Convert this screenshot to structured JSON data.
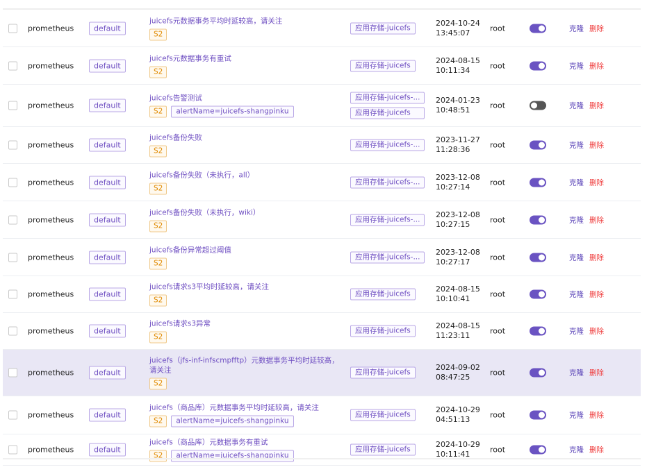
{
  "labels": {
    "clone": "克隆",
    "delete": "删除"
  },
  "rows": [
    {
      "source": "prometheus",
      "namespace": "default",
      "name": "juicefs元数据事务平均时延较高，请关注",
      "severity": "S2",
      "extra_label": null,
      "groups": [
        "应用存储-juicefs"
      ],
      "date": "2024-10-24",
      "time": "13:45:07",
      "user": "root",
      "enabled": true
    },
    {
      "source": "prometheus",
      "namespace": "default",
      "name": "juicefs元数据事务有重试",
      "severity": "S2",
      "extra_label": null,
      "groups": [
        "应用存储-juicefs"
      ],
      "date": "2024-08-15",
      "time": "10:11:34",
      "user": "root",
      "enabled": true
    },
    {
      "source": "prometheus",
      "namespace": "default",
      "name": "juicefs告警测试",
      "severity": "S2",
      "extra_label": "alertName=juicefs-shangpinku",
      "groups": [
        "应用存储-juicefs-...",
        "应用存储-juicefs"
      ],
      "date": "2024-01-23",
      "time": "10:48:51",
      "user": "root",
      "enabled": false
    },
    {
      "source": "prometheus",
      "namespace": "default",
      "name": "juicefs备份失败",
      "severity": "S2",
      "extra_label": null,
      "groups": [
        "应用存储-juicefs-..."
      ],
      "date": "2023-11-27",
      "time": "11:28:36",
      "user": "root",
      "enabled": true
    },
    {
      "source": "prometheus",
      "namespace": "default",
      "name": "juicefs备份失败（未执行，all）",
      "severity": "S2",
      "extra_label": null,
      "groups": [
        "应用存储-juicefs-..."
      ],
      "date": "2023-12-08",
      "time": "10:27:14",
      "user": "root",
      "enabled": true
    },
    {
      "source": "prometheus",
      "namespace": "default",
      "name": "juicefs备份失败（未执行，wiki）",
      "severity": "S2",
      "extra_label": null,
      "groups": [
        "应用存储-juicefs-..."
      ],
      "date": "2023-12-08",
      "time": "10:27:15",
      "user": "root",
      "enabled": true
    },
    {
      "source": "prometheus",
      "namespace": "default",
      "name": "juicefs备份异常超过阈值",
      "severity": "S2",
      "extra_label": null,
      "groups": [
        "应用存储-juicefs-..."
      ],
      "date": "2023-12-08",
      "time": "10:27:17",
      "user": "root",
      "enabled": true
    },
    {
      "source": "prometheus",
      "namespace": "default",
      "name": "juicefs请求s3平均时延较高，请关注",
      "severity": "S2",
      "extra_label": null,
      "groups": [
        "应用存储-juicefs"
      ],
      "date": "2024-08-15",
      "time": "10:10:41",
      "user": "root",
      "enabled": true
    },
    {
      "source": "prometheus",
      "namespace": "default",
      "name": "juicefs请求s3异常",
      "severity": "S2",
      "extra_label": null,
      "groups": [
        "应用存储-juicefs"
      ],
      "date": "2024-08-15",
      "time": "11:23:11",
      "user": "root",
      "enabled": true
    },
    {
      "source": "prometheus",
      "namespace": "default",
      "name": "juicefs（jfs-inf-infscmpfftp）元数据事务平均时延较高，",
      "name2": "请关注",
      "severity": "S2",
      "extra_label": null,
      "groups": [
        "应用存储-juicefs"
      ],
      "date": "2024-09-02",
      "time": "08:47:25",
      "user": "root",
      "enabled": true,
      "highlighted": true
    },
    {
      "source": "prometheus",
      "namespace": "default",
      "name": "juicefs（商品库）元数据事务平均时延较高，请关注",
      "severity": "S2",
      "extra_label": "alertName=juicefs-shangpinku",
      "groups": [
        "应用存储-juicefs"
      ],
      "date": "2024-10-29",
      "time": "04:51:13",
      "user": "root",
      "enabled": true
    },
    {
      "source": "prometheus",
      "namespace": "default",
      "name": "juicefs（商品库）元数据事务有重试",
      "severity": "S2",
      "extra_label": "alertName=juicefs-shangpinku",
      "groups": [
        "应用存储-juicefs"
      ],
      "date": "2024-10-29",
      "time": "10:11:41",
      "user": "root",
      "enabled": true
    }
  ]
}
